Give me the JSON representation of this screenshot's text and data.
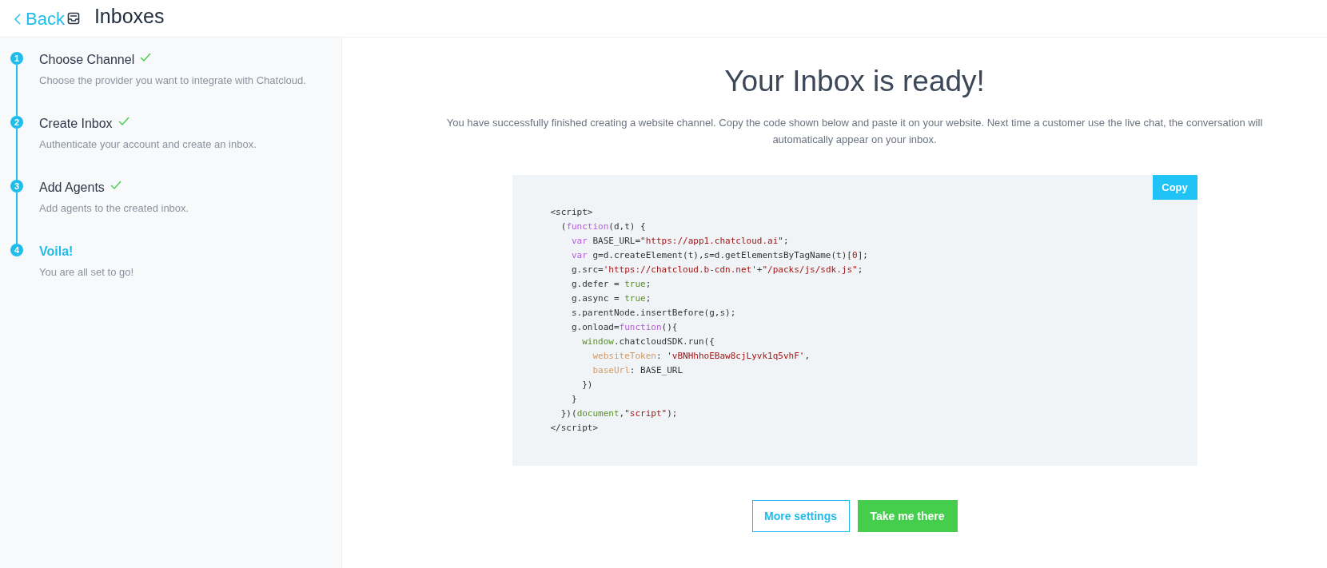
{
  "header": {
    "back_label": "Back",
    "title": "Inboxes"
  },
  "steps": [
    {
      "number": "1",
      "title": "Choose Channel",
      "description": "Choose the provider you want to integrate with Chatcloud.",
      "completed": true,
      "selected": false
    },
    {
      "number": "2",
      "title": "Create Inbox",
      "description": "Authenticate your account and create an inbox.",
      "completed": true,
      "selected": false
    },
    {
      "number": "3",
      "title": "Add Agents",
      "description": "Add agents to the created inbox.",
      "completed": true,
      "selected": false
    },
    {
      "number": "4",
      "title": "Voila!",
      "description": "You are all set to go!",
      "completed": false,
      "selected": true
    }
  ],
  "main": {
    "heading": "Your Inbox is ready!",
    "message": "You have successfully finished creating a website channel. Copy the code shown below and paste it on your website. Next time a customer use the live chat, the conversation will automatically appear on your inbox."
  },
  "code": {
    "copy_label": "Copy",
    "lines": [
      [
        {
          "text": "<script>",
          "kind": "plain"
        }
      ],
      [
        {
          "text": "  (",
          "kind": "plain"
        },
        {
          "text": "function",
          "kind": "keyword"
        },
        {
          "text": "(d,t) {",
          "kind": "plain"
        }
      ],
      [
        {
          "text": "    var",
          "kind": "keyword"
        },
        {
          "text": " BASE_URL=",
          "kind": "plain"
        },
        {
          "text": "\"https://app1.chatcloud.ai\"",
          "kind": "string"
        },
        {
          "text": ";",
          "kind": "plain"
        }
      ],
      [
        {
          "text": "    var",
          "kind": "keyword"
        },
        {
          "text": " g=d.createElement(t),s=d.getElementsByTagName(t)[",
          "kind": "plain"
        },
        {
          "text": "0",
          "kind": "string"
        },
        {
          "text": "];",
          "kind": "plain"
        }
      ],
      [
        {
          "text": "    g.src=",
          "kind": "plain"
        },
        {
          "text": "'https://chatcloud.b-cdn.net'",
          "kind": "string"
        },
        {
          "text": "+",
          "kind": "plain"
        },
        {
          "text": "\"/packs/js/sdk.js\"",
          "kind": "string"
        },
        {
          "text": ";",
          "kind": "plain"
        }
      ],
      [
        {
          "text": "    g.defer = ",
          "kind": "plain"
        },
        {
          "text": "true",
          "kind": "literal"
        },
        {
          "text": ";",
          "kind": "plain"
        }
      ],
      [
        {
          "text": "    g.async = ",
          "kind": "plain"
        },
        {
          "text": "true",
          "kind": "literal"
        },
        {
          "text": ";",
          "kind": "plain"
        }
      ],
      [
        {
          "text": "    s.parentNode.insertBefore(g,s);",
          "kind": "plain"
        }
      ],
      [
        {
          "text": "    g.onload=",
          "kind": "plain"
        },
        {
          "text": "function",
          "kind": "keyword"
        },
        {
          "text": "(){",
          "kind": "plain"
        }
      ],
      [
        {
          "text": "      window",
          "kind": "literal"
        },
        {
          "text": ".chatcloudSDK.run({",
          "kind": "plain"
        }
      ],
      [
        {
          "text": "        websiteToken",
          "kind": "property"
        },
        {
          "text": ": ",
          "kind": "plain"
        },
        {
          "text": "'vBNHhhoEBaw8cjLyvk1q5vhF'",
          "kind": "string"
        },
        {
          "text": ",",
          "kind": "plain"
        }
      ],
      [
        {
          "text": "        baseUrl",
          "kind": "property"
        },
        {
          "text": ": BASE_URL",
          "kind": "plain"
        }
      ],
      [
        {
          "text": "      })",
          "kind": "plain"
        }
      ],
      [
        {
          "text": "    }",
          "kind": "plain"
        }
      ],
      [
        {
          "text": "  })(",
          "kind": "plain"
        },
        {
          "text": "document",
          "kind": "literal"
        },
        {
          "text": ",",
          "kind": "plain"
        },
        {
          "text": "\"script\"",
          "kind": "string"
        },
        {
          "text": ");",
          "kind": "plain"
        }
      ],
      [
        {
          "text": "</script>",
          "kind": "plain"
        }
      ]
    ]
  },
  "buttons": [
    {
      "label": "More settings",
      "kind": "secondary"
    },
    {
      "label": "Take me there",
      "kind": "primary"
    }
  ]
}
